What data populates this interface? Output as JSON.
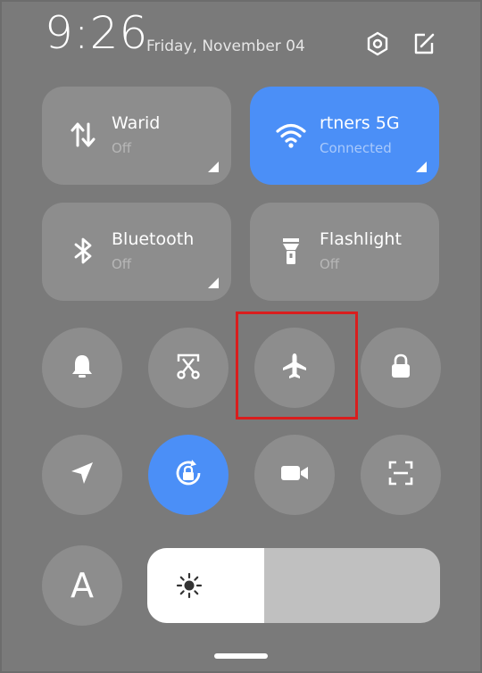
{
  "header": {
    "time": "9:26",
    "date": "Friday, November 04",
    "settings_icon": "settings-hexagon-icon",
    "edit_icon": "edit-icon"
  },
  "tiles": {
    "mobile_data": {
      "label": "Warid",
      "status": "Off",
      "icon": "mobile-data-icon"
    },
    "wifi": {
      "label": "rtners 5G",
      "status": "Connected",
      "icon": "wifi-icon"
    },
    "bluetooth": {
      "label": "Bluetooth",
      "status": "Off",
      "icon": "bluetooth-icon"
    },
    "flashlight": {
      "label": "Flashlight",
      "status": "Off",
      "icon": "flashlight-icon"
    }
  },
  "toggles": [
    {
      "name": "ring",
      "icon": "bell-icon",
      "active": false
    },
    {
      "name": "screenshot",
      "icon": "scissors-icon",
      "active": false
    },
    {
      "name": "airplane-mode",
      "icon": "airplane-icon",
      "active": false
    },
    {
      "name": "lock-screen",
      "icon": "lock-icon",
      "active": false
    },
    {
      "name": "location",
      "icon": "navigation-arrow-icon",
      "active": false
    },
    {
      "name": "auto-rotate-lock",
      "icon": "rotation-lock-icon",
      "active": true
    },
    {
      "name": "screen-recorder",
      "icon": "video-camera-icon",
      "active": false
    },
    {
      "name": "scanner",
      "icon": "scan-frame-icon",
      "active": false
    }
  ],
  "font_button": {
    "label": "A"
  },
  "brightness": {
    "level": 0.4,
    "icon": "sun-icon"
  },
  "colors": {
    "background": "#7a7a7a",
    "tile": "#8d8d8d",
    "accent": "#4b8ff7",
    "highlight": "#d91e1e"
  }
}
